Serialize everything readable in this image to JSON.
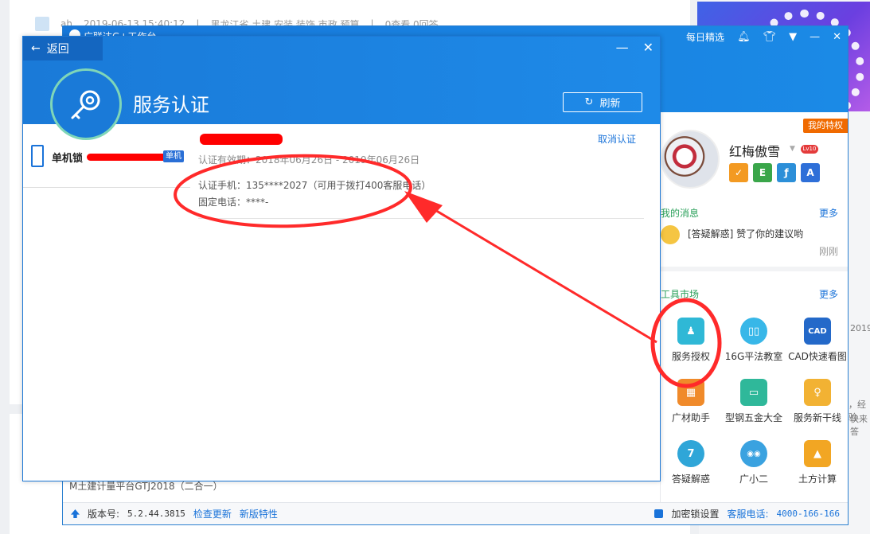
{
  "background": {
    "row": {
      "user": "ah",
      "time": "2019-06-13 15:40:12",
      "sep1": "|",
      "tags": "黑龙江省 土建 安装 装饰 市政 预算",
      "sep2": "|",
      "stats": "0查看 0回答"
    },
    "side_date": "2019-",
    "side_text1": "，经验",
    "side_text2": "快来答"
  },
  "workbench": {
    "title": "广联达G+工作台",
    "top_links": {
      "daily": "每日精选"
    },
    "gtj_text": "M土建计量平台GTJ2018（二合一）",
    "footer": {
      "version_label": "版本号:",
      "version_value": "5.2.44.3815",
      "check_update": "检查更新",
      "new_features": "新版特性",
      "lock_settings": "加密锁设置",
      "hotline_label": "客服电话:",
      "hotline_value": "4000-166-166"
    }
  },
  "user_panel": {
    "privilege_badge": "我的特权",
    "username": "红梅傲雪",
    "level": "Lv10",
    "badges": [
      "✓",
      "E",
      "ƒ",
      "A"
    ],
    "messages_title": "我的消息",
    "messages_more": "更多",
    "message_text": "[答疑解惑] 赞了你的建议哟",
    "message_time": "刚刚",
    "tools_title": "工具市场",
    "tools_more": "更多",
    "tools": [
      {
        "label": "服务授权",
        "icon": "service-auth",
        "color": "#2fb8d6",
        "glyph": "♟"
      },
      {
        "label": "16G平法教室",
        "icon": "book",
        "color": "#38b7e8",
        "glyph": "▯▯"
      },
      {
        "label": "CAD快速看图",
        "icon": "cad",
        "color": "#2469c9",
        "glyph": "CAD"
      },
      {
        "label": "广材助手",
        "icon": "bricks",
        "color": "#f08a2a",
        "glyph": "▦"
      },
      {
        "label": "型钢五金大全",
        "icon": "steel",
        "color": "#2fb89a",
        "glyph": "▭"
      },
      {
        "label": "服务新干线",
        "icon": "bulb",
        "color": "#f2b233",
        "glyph": "♀"
      },
      {
        "label": "答疑解惑",
        "icon": "qa",
        "color": "#2fa6d8",
        "glyph": "7"
      },
      {
        "label": "广小二",
        "icon": "mascot",
        "color": "#3aa2e0",
        "glyph": "◉◉"
      },
      {
        "label": "土方计算",
        "icon": "earthwork",
        "color": "#f2a623",
        "glyph": "▲"
      }
    ]
  },
  "dialog": {
    "back_label": "返回",
    "title": "服务认证",
    "refresh_label": "刷新",
    "lock_name": "单机锁",
    "lock_tag": "单机",
    "cancel_label": "取消认证",
    "validity": "认证有效期：2018年06月26日 - 2019年06月26日",
    "phone": "认证手机：135****2027（可用于拨打400客服电话）",
    "landline": "固定电话：****-"
  },
  "colors": {
    "primary": "#1a7ad8",
    "annotation": "#ff2a2a",
    "link": "#1a73d9",
    "accent_orange": "#f06a00"
  }
}
